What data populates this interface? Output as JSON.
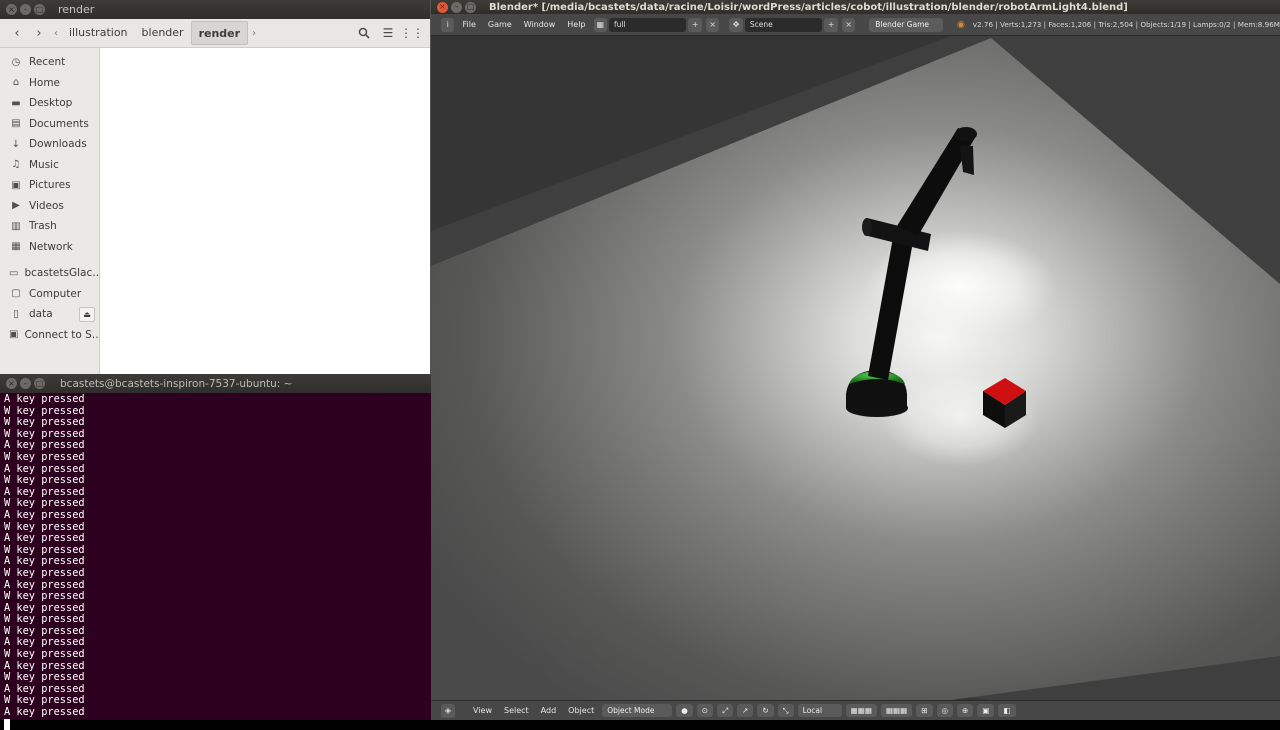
{
  "file_manager": {
    "title": "render",
    "breadcrumbs": [
      "illustration",
      "blender",
      "render"
    ],
    "sidebar": [
      {
        "label": "Recent",
        "icon": "clock-icon",
        "glyph": "◷"
      },
      {
        "label": "Home",
        "icon": "home-icon",
        "glyph": "⌂"
      },
      {
        "label": "Desktop",
        "icon": "desktop-folder-icon",
        "glyph": "▬"
      },
      {
        "label": "Documents",
        "icon": "documents-icon",
        "glyph": "▤"
      },
      {
        "label": "Downloads",
        "icon": "download-icon",
        "glyph": "↓"
      },
      {
        "label": "Music",
        "icon": "music-icon",
        "glyph": "♫"
      },
      {
        "label": "Pictures",
        "icon": "pictures-icon",
        "glyph": "▣"
      },
      {
        "label": "Videos",
        "icon": "videos-icon",
        "glyph": "▶"
      },
      {
        "label": "Trash",
        "icon": "trash-icon",
        "glyph": "▥"
      },
      {
        "label": "Network",
        "icon": "network-icon",
        "glyph": "▦"
      }
    ],
    "devices": [
      {
        "label": "bcastetsGlac…",
        "icon": "drive-icon",
        "glyph": "▭"
      },
      {
        "label": "Computer",
        "icon": "computer-icon",
        "glyph": "▢"
      },
      {
        "label": "data",
        "icon": "disk-icon",
        "glyph": "▯",
        "eject": true
      },
      {
        "label": "Connect to S…",
        "icon": "connect-server-icon",
        "glyph": "▣"
      }
    ]
  },
  "terminal": {
    "title": "bcastets@bcastets-inspiron-7537-ubuntu: ~",
    "lines": [
      "A key pressed",
      "W key pressed",
      "W key pressed",
      "W key pressed",
      "A key pressed",
      "W key pressed",
      "A key pressed",
      "W key pressed",
      "A key pressed",
      "W key pressed",
      "A key pressed",
      "W key pressed",
      "A key pressed",
      "W key pressed",
      "A key pressed",
      "W key pressed",
      "A key pressed",
      "W key pressed",
      "A key pressed",
      "W key pressed",
      "W key pressed",
      "A key pressed",
      "W key pressed",
      "A key pressed",
      "W key pressed",
      "A key pressed",
      "W key pressed",
      "A key pressed"
    ]
  },
  "blender": {
    "title": "Blender* [/media/bcastets/data/racine/Loisir/wordPress/articles/cobot/illustration/blender/robotArmLight4.blend]",
    "menus": [
      "File",
      "Game",
      "Window",
      "Help"
    ],
    "screen_layout": "full",
    "scene": "Scene",
    "engine": "Blender Game",
    "stats": "v2.76 | Verts:1,273 | Faces:1,206 | Tris:2,504 | Objects:1/19 | Lamps:0/2 | Mem:8.96M",
    "footer_menus": [
      "View",
      "Select",
      "Add",
      "Object"
    ],
    "mode": "Object Mode",
    "orientation": "Local",
    "colors": {
      "cube_top": "#d01010",
      "base_ring": "#2b8a2b",
      "viewport_bg": "#2c2c2c"
    }
  }
}
